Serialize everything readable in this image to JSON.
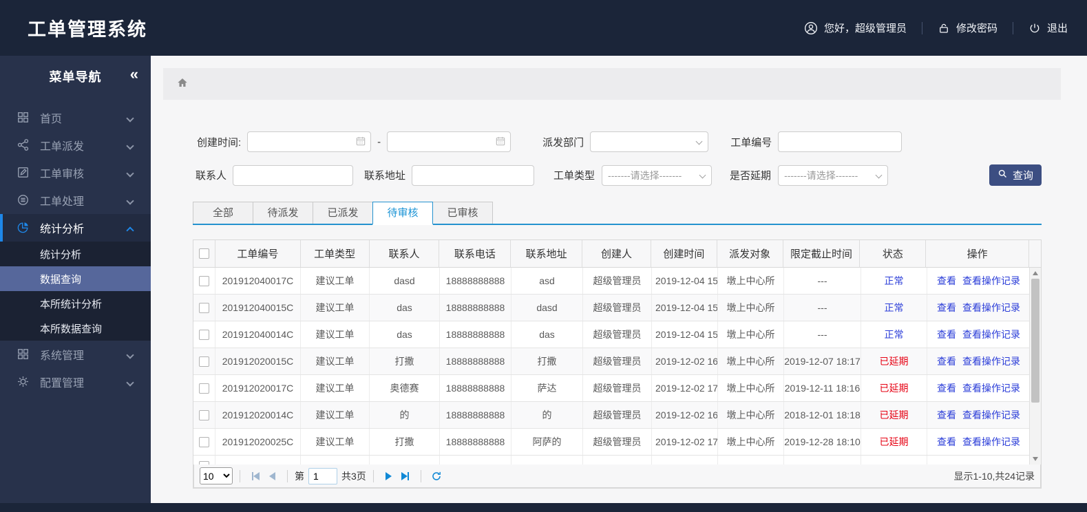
{
  "app": {
    "title": "工单管理系统"
  },
  "header": {
    "greeting": "您好，超级管理员",
    "change_password": "修改密码",
    "logout": "退出"
  },
  "icons": {
    "user": "user-icon",
    "lock": "lock-icon",
    "power": "power-icon",
    "home": "home-icon",
    "calendar": "calendar-icon",
    "search": "search-icon",
    "refresh": "refresh-icon",
    "collapse": "double-chevron-left-icon"
  },
  "sidebar": {
    "title": "菜单导航",
    "collapse_glyph": "«",
    "items": [
      {
        "label": "首页",
        "icon": "dashboard-icon",
        "active": false
      },
      {
        "label": "工单派发",
        "icon": "share-icon",
        "active": false
      },
      {
        "label": "工单审核",
        "icon": "edit-icon",
        "active": false
      },
      {
        "label": "工单处理",
        "icon": "process-icon",
        "active": false
      },
      {
        "label": "统计分析",
        "icon": "pie-chart-icon",
        "active": true,
        "children": [
          {
            "label": "统计分析",
            "active": false
          },
          {
            "label": "数据查询",
            "active": true
          },
          {
            "label": "本所统计分析",
            "active": false
          },
          {
            "label": "本所数据查询",
            "active": false
          }
        ]
      },
      {
        "label": "系统管理",
        "icon": "system-icon",
        "active": false
      },
      {
        "label": "配置管理",
        "icon": "gear-icon",
        "active": false
      }
    ]
  },
  "search": {
    "created_time_label": "创建时间:",
    "range_separator": "-",
    "dispatch_dept_label": "派发部门",
    "order_no_label": "工单编号",
    "contact_label": "联系人",
    "address_label": "联系地址",
    "order_type_label": "工单类型",
    "delay_label": "是否延期",
    "select_placeholder": "-------请选择-------",
    "query_button": "查询"
  },
  "tabs": [
    {
      "label": "全部",
      "active": false
    },
    {
      "label": "待派发",
      "active": false
    },
    {
      "label": "已派发",
      "active": false
    },
    {
      "label": "待审核",
      "active": true
    },
    {
      "label": "已审核",
      "active": false
    }
  ],
  "table": {
    "columns": [
      "工单编号",
      "工单类型",
      "联系人",
      "联系电话",
      "联系地址",
      "创建人",
      "创建时间",
      "派发对象",
      "限定截止时间",
      "状态",
      "操作"
    ],
    "action_labels": [
      "查看",
      "查看操作记录"
    ],
    "status_colors": {
      "正常": "#2a3cd8",
      "已延期": "#e60012"
    },
    "rows": [
      {
        "order_no": "201912040017C",
        "type": "建议工单",
        "contact": "dasd",
        "phone": "18888888888",
        "address": "asd",
        "creator": "超级管理员",
        "created": "2019-12-04 15",
        "target": "墩上中心所",
        "deadline": "---",
        "status": "正常"
      },
      {
        "order_no": "201912040015C",
        "type": "建议工单",
        "contact": "das",
        "phone": "18888888888",
        "address": "dasd",
        "creator": "超级管理员",
        "created": "2019-12-04 15",
        "target": "墩上中心所",
        "deadline": "---",
        "status": "正常"
      },
      {
        "order_no": "201912040014C",
        "type": "建议工单",
        "contact": "das",
        "phone": "18888888888",
        "address": "das",
        "creator": "超级管理员",
        "created": "2019-12-04 15",
        "target": "墩上中心所",
        "deadline": "---",
        "status": "正常"
      },
      {
        "order_no": "201912020015C",
        "type": "建议工单",
        "contact": "打撒",
        "phone": "18888888888",
        "address": "打撒",
        "creator": "超级管理员",
        "created": "2019-12-02 16",
        "target": "墩上中心所",
        "deadline": "2019-12-07 18:17",
        "status": "已延期"
      },
      {
        "order_no": "201912020017C",
        "type": "建议工单",
        "contact": "奥德赛",
        "phone": "18888888888",
        "address": "萨达",
        "creator": "超级管理员",
        "created": "2019-12-02 17",
        "target": "墩上中心所",
        "deadline": "2019-12-11 18:16",
        "status": "已延期"
      },
      {
        "order_no": "201912020014C",
        "type": "建议工单",
        "contact": "的",
        "phone": "18888888888",
        "address": "的",
        "creator": "超级管理员",
        "created": "2019-12-02 16",
        "target": "墩上中心所",
        "deadline": "2018-12-01 18:18",
        "status": "已延期"
      },
      {
        "order_no": "201912020025C",
        "type": "建议工单",
        "contact": "打撒",
        "phone": "18888888888",
        "address": "阿萨的",
        "creator": "超级管理员",
        "created": "2019-12-02 17",
        "target": "墩上中心所",
        "deadline": "2019-12-28 18:10",
        "status": "已延期"
      }
    ],
    "partial_row_visible": true
  },
  "pagination": {
    "page_size": "10",
    "page_prefix": "第",
    "current_page": "1",
    "total_pages": "共3页",
    "summary": "显示1-10,共24记录"
  }
}
